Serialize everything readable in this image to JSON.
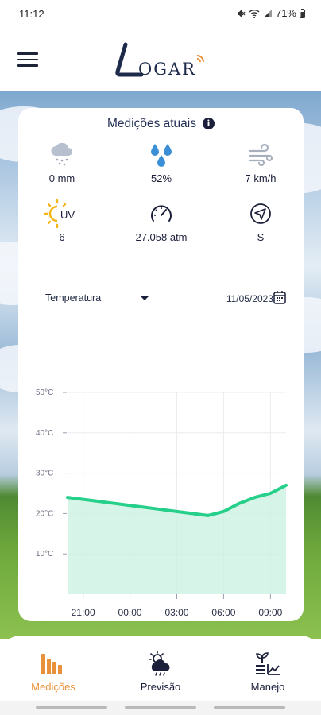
{
  "status_bar": {
    "time": "11:12",
    "battery": "71%"
  },
  "header": {
    "menu_icon": "hamburger-menu-icon",
    "logo": "LOGAR"
  },
  "card": {
    "title": "Medições atuais",
    "info_icon": "info-icon",
    "metrics": [
      {
        "icon": "rain-cloud-icon",
        "value": "0 mm"
      },
      {
        "icon": "humidity-drops-icon",
        "value": "52%"
      },
      {
        "icon": "wind-icon",
        "value": "7 km/h"
      },
      {
        "icon": "sun-uv-icon",
        "icon_text": "UV",
        "value": "6"
      },
      {
        "icon": "gauge-icon",
        "value": "27.058 atm"
      },
      {
        "icon": "direction-arrow-icon",
        "value": "S"
      }
    ],
    "selector": {
      "value": "Temperatura"
    },
    "date": {
      "value": "11/05/2023"
    }
  },
  "chart_data": {
    "type": "area",
    "x": [
      "20:00",
      "21:00",
      "22:00",
      "23:00",
      "00:00",
      "01:00",
      "02:00",
      "03:00",
      "04:00",
      "05:00",
      "06:00",
      "07:00",
      "08:00",
      "09:00",
      "10:00"
    ],
    "xtick_labels": [
      "21:00",
      "00:00",
      "03:00",
      "06:00",
      "09:00"
    ],
    "series": [
      {
        "values": [
          24,
          23.5,
          23,
          22.5,
          22,
          21.5,
          21,
          20.5,
          20,
          19.5,
          20.5,
          22.5,
          24,
          25,
          27
        ]
      }
    ],
    "ytick_labels": [
      "10°C",
      "20°C",
      "30°C",
      "40°C",
      "50°C"
    ],
    "ylim": [
      0,
      50
    ],
    "colors": {
      "line": "#26d08a",
      "fill": "#c8f2e0"
    },
    "grid": true
  },
  "bottom_nav": {
    "items": [
      {
        "label": "Medições",
        "icon": "bar-chart-icon",
        "active": true
      },
      {
        "label": "Previsão",
        "icon": "cloud-sun-icon",
        "active": false
      },
      {
        "label": "Manejo",
        "icon": "plant-chart-icon",
        "active": false
      }
    ]
  },
  "colors": {
    "accent": "#e8913a",
    "navy": "#1b1f3a",
    "chart_line": "#26d08a"
  }
}
